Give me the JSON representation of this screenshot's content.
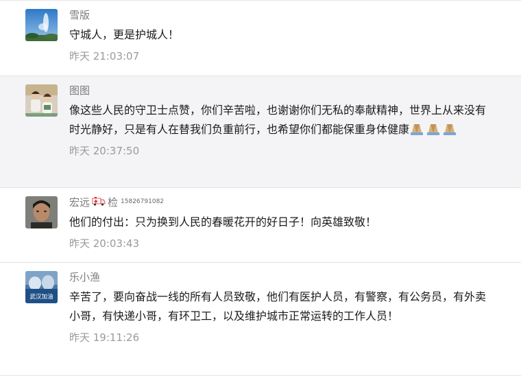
{
  "comments": [
    {
      "nickname": "雪版",
      "text": "守城人，更是护城人！",
      "time": "昨天 21:03:07"
    },
    {
      "nickname": "图图",
      "text": "像这些人民的守卫士点赞，你们辛苦啦，也谢谢你们无私的奉献精神，世界上从来没有时光静好，只是有人在替我们负重前行，也希望你们都能保重身体健康",
      "emoji": "pray-hands-icon",
      "time": "昨天 20:37:50"
    },
    {
      "nickname_part1": "宏远",
      "nickname_part2": "检",
      "nickname_sup": "15826791082",
      "nickname_icon": "ambulance-icon",
      "text": "他们的付出：只为换到人民的春暖花开的好日子！向英雄致敬！",
      "time": "昨天 20:03:43"
    },
    {
      "nickname": "乐小渔",
      "text": "辛苦了，要向奋战一线的所有人员致敬，他们有医护人员，有警察，有公务员，有外卖小哥，有快递小哥，有环卫工，以及维护城市正常运转的工作人员！",
      "avatar_text": "武汉加油",
      "time": "昨天 19:11:26"
    }
  ]
}
